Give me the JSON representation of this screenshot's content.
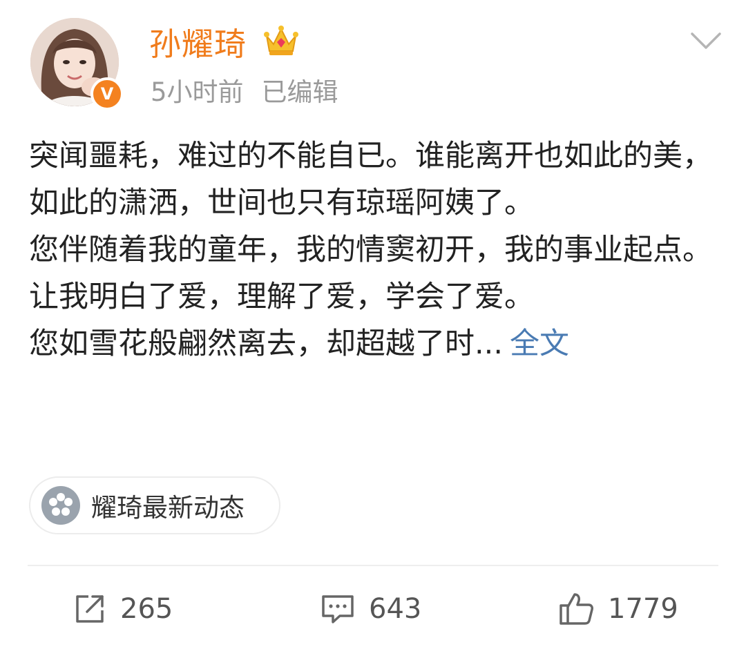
{
  "post": {
    "author": {
      "name": "孙耀琦",
      "verified_mark": "V",
      "avatar_icon": "avatar",
      "crown_icon": "vip-crown-icon"
    },
    "time": "5小时前",
    "edited": "已编辑",
    "content": {
      "paragraphs": [
        "突闻噩耗，难过的不能自已。谁能离开也如此的美，如此的潇洒，世间也只有琼瑶阿姨了。",
        "您伴随着我的童年，我的情窦初开，我的事业起点。",
        "让我明白了爱，理解了爱，学会了爱。"
      ],
      "truncated_line": "您如雪花般翩然离去，却超越了时...",
      "full_text_link": "全文"
    },
    "topic": {
      "label": "耀琦最新动态",
      "icon": "topic-flower-icon"
    },
    "actions": {
      "repost": {
        "icon": "repost-icon",
        "count": "265"
      },
      "comment": {
        "icon": "comment-icon",
        "count": "643"
      },
      "like": {
        "icon": "like-icon",
        "count": "1779"
      }
    }
  },
  "colors": {
    "name": "#f07c1c",
    "verified_badge": "#f48220",
    "link": "#4a7bb3",
    "meta": "#9a9a9a",
    "text": "#222222"
  }
}
